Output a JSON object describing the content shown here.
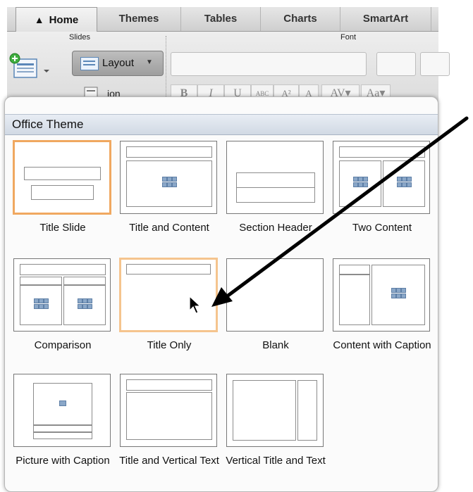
{
  "tabs": [
    "Home",
    "Themes",
    "Tables",
    "Charts",
    "SmartArt"
  ],
  "ribbon": {
    "slides_group": "Slides",
    "font_group": "Font",
    "layout_label": "Layout",
    "section_label": "ion"
  },
  "gallery": {
    "header": "Office Theme",
    "layouts": [
      {
        "label": "Title Slide",
        "state": "selected"
      },
      {
        "label": "Title and Content"
      },
      {
        "label": "Section Header"
      },
      {
        "label": "Two Content"
      },
      {
        "label": "Comparison"
      },
      {
        "label": "Title Only",
        "state": "hovered"
      },
      {
        "label": "Blank"
      },
      {
        "label": "Content with Caption"
      },
      {
        "label": "Picture with Caption"
      },
      {
        "label": "Title and Vertical Text"
      },
      {
        "label": "Vertical Title and Text"
      }
    ]
  },
  "colors": {
    "selected_border": "#f0a860",
    "hover_border": "#f5c48e",
    "annotation_arrow": "#000000"
  }
}
